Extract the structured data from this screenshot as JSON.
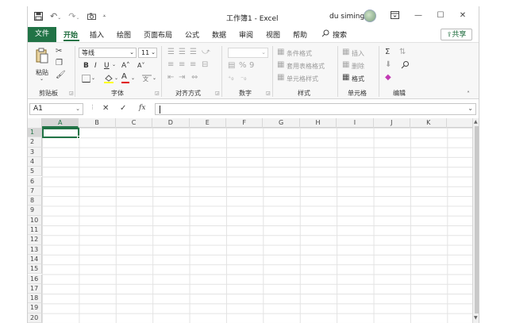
{
  "titlebar": {
    "title": "工作簿1 - Excel",
    "user": "du siming",
    "qat": {
      "save_icon": "save-icon",
      "undo_icon": "undo-icon",
      "redo_icon": "redo-icon",
      "camera_icon": "camera-icon",
      "customize_icon": "customize-qat-icon"
    },
    "controls": {
      "ribbon_display_icon": "ribbon-display-icon",
      "minimize": "—",
      "maximize": "☐",
      "close": "✕"
    }
  },
  "tabs": {
    "file": "文件",
    "items": [
      "开始",
      "插入",
      "绘图",
      "页面布局",
      "公式",
      "数据",
      "审阅",
      "视图",
      "帮助"
    ],
    "active": "开始",
    "search": "搜索",
    "share": "共享"
  },
  "ribbon": {
    "clipboard": {
      "paste": "粘贴",
      "label": "剪贴板"
    },
    "font": {
      "name": "等线",
      "size": "11",
      "bold": "B",
      "italic": "I",
      "underline": "U",
      "grow": "A˄",
      "shrink": "A˅",
      "label": "字体"
    },
    "alignment": {
      "label": "对齐方式"
    },
    "number": {
      "label": "数字"
    },
    "styles": {
      "conditional": "条件格式",
      "table": "套用表格格式",
      "cell": "单元格样式",
      "label": "样式"
    },
    "cells": {
      "insert": "插入",
      "delete": "删除",
      "format": "格式",
      "label": "单元格"
    },
    "editing": {
      "label": "编辑"
    }
  },
  "formula_bar": {
    "name_box": "A1",
    "cancel": "✕",
    "enter": "✓",
    "fx": "fx",
    "value": ""
  },
  "grid": {
    "columns": [
      "A",
      "B",
      "C",
      "D",
      "E",
      "F",
      "G",
      "H",
      "I",
      "J",
      "K"
    ],
    "rows": [
      "1",
      "2",
      "3",
      "4",
      "5",
      "6",
      "7",
      "8",
      "9",
      "10",
      "11",
      "12",
      "13",
      "14",
      "15",
      "16",
      "17",
      "18",
      "19",
      "20"
    ],
    "active_cell": "A1"
  },
  "colors": {
    "accent": "#217346"
  }
}
